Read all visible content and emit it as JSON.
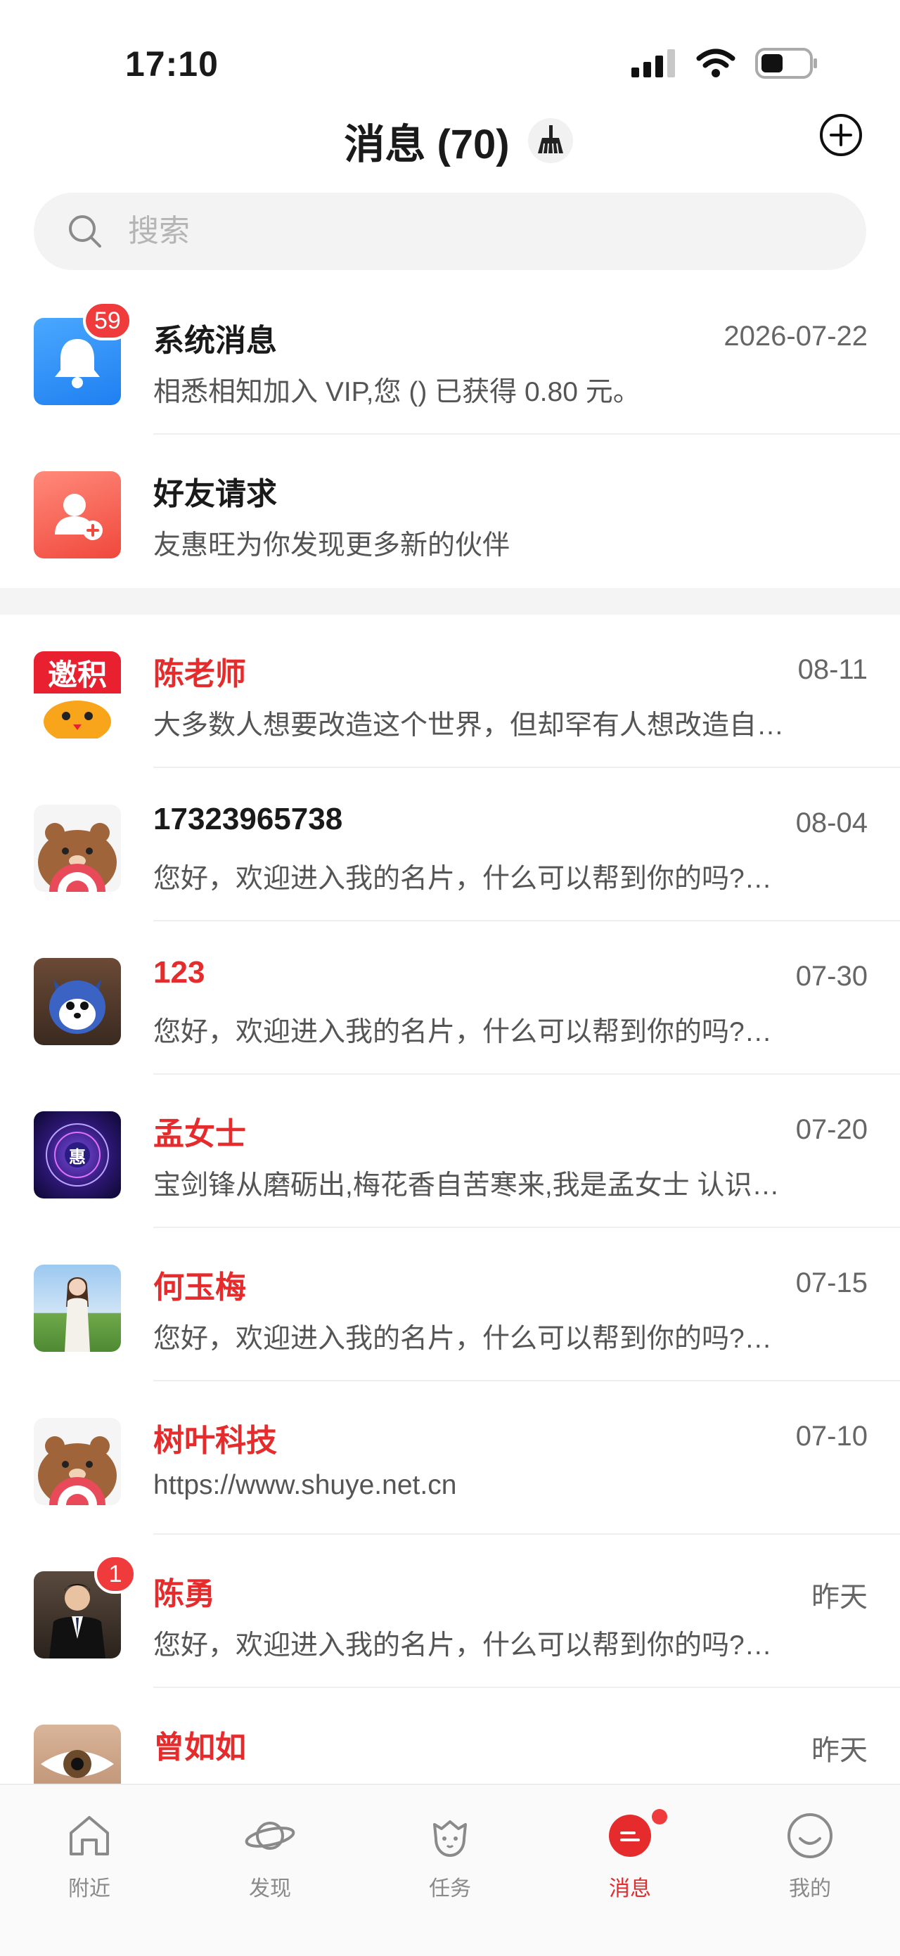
{
  "status_bar": {
    "time": "17:10"
  },
  "header": {
    "title": "消息 (70)"
  },
  "search": {
    "placeholder": "搜索"
  },
  "system_items": [
    {
      "name": "系统消息",
      "date": "2026-07-22",
      "preview": "相悉相知加入 VIP,您 () 已获得 0.80 元。",
      "badge": "59",
      "icon": "bell-icon"
    },
    {
      "name": "好友请求",
      "date": "",
      "preview": "友惠旺为你发现更多新的伙伴",
      "badge": "",
      "icon": "add-friend-icon"
    }
  ],
  "chats": [
    {
      "name": "陈老师",
      "date": "08-11",
      "preview": "大多数人想要改造这个世界，但却罕有人想改造自…",
      "red": true,
      "avatar": "logo-avatar",
      "avatar_text": "邀积",
      "badge": ""
    },
    {
      "name": "17323965738",
      "date": "08-04",
      "preview": "您好，欢迎进入我的名片，什么可以帮到你的吗?…",
      "red": false,
      "avatar": "bear-avatar",
      "badge": ""
    },
    {
      "name": "123",
      "date": "07-30",
      "preview": "您好，欢迎进入我的名片，什么可以帮到你的吗?…",
      "red": true,
      "avatar": "plush-avatar",
      "badge": ""
    },
    {
      "name": "孟女士",
      "date": "07-20",
      "preview": "宝剑锋从磨砺出,梅花香自苦寒来,我是孟女士 认识…",
      "red": true,
      "avatar": "globe-avatar",
      "avatar_text": "惠",
      "badge": ""
    },
    {
      "name": "何玉梅",
      "date": "07-15",
      "preview": "您好，欢迎进入我的名片，什么可以帮到你的吗?…",
      "red": true,
      "avatar": "photo-avatar",
      "badge": ""
    },
    {
      "name": "树叶科技",
      "date": "07-10",
      "preview": "https://www.shuye.net.cn",
      "red": true,
      "avatar": "bear-avatar",
      "badge": ""
    },
    {
      "name": "陈勇",
      "date": "昨天",
      "preview": "您好，欢迎进入我的名片，什么可以帮到你的吗?…",
      "red": true,
      "avatar": "suit-avatar",
      "badge": "1"
    },
    {
      "name": "曾如如",
      "date": "昨天",
      "preview": "",
      "red": true,
      "avatar": "eye-avatar",
      "badge": ""
    }
  ],
  "tabs": [
    {
      "label": "附近",
      "icon": "home-icon",
      "active": false
    },
    {
      "label": "发现",
      "icon": "planet-icon",
      "active": false
    },
    {
      "label": "任务",
      "icon": "mascot-icon",
      "active": false
    },
    {
      "label": "消息",
      "icon": "message-icon",
      "active": true
    },
    {
      "label": "我的",
      "icon": "smile-icon",
      "active": false
    }
  ],
  "colors": {
    "accent": "#e52b2b",
    "badge": "#ef3b3b",
    "search_bg": "#f3f3f3"
  }
}
